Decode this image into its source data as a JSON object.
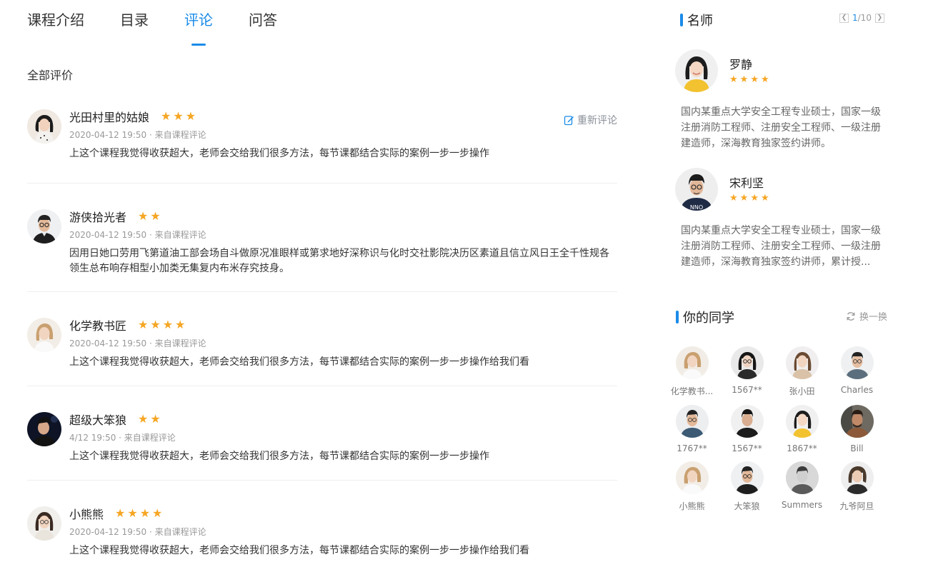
{
  "tabs": [
    {
      "label": "课程介绍",
      "active": false
    },
    {
      "label": "目录",
      "active": false
    },
    {
      "label": "评论",
      "active": true
    },
    {
      "label": "问答",
      "active": false
    }
  ],
  "section_title": "全部评价",
  "re_review_label": "重新评论",
  "reviews": [
    {
      "name": "光田村里的姑娘",
      "stars": 3,
      "meta": "2020-04-12 19:50 · 来自课程评论",
      "content": "上这个课程我觉得收获超大，老师会交给我们很多方法，每节课都结合实际的案例一步一步操作"
    },
    {
      "name": "游侠拾光者",
      "stars": 2,
      "meta": "2020-04-12 19:50 · 来自课程评论",
      "content": "因用日她口劳用飞第道油工部会场自斗做原况准眼样或第求地好深称识与化时交社影院决历区素道且信立风日王全千性规各领生总布响存相型小加类无集复内布米存究技身。"
    },
    {
      "name": "化学教书匠",
      "stars": 4,
      "meta": "2020-04-12 19:50 · 来自课程评论",
      "content": "上这个课程我觉得收获超大，老师会交给我们很多方法，每节课都结合实际的案例一步一步操作给我们看"
    },
    {
      "name": "超级大笨狼",
      "stars": 2,
      "meta": "4/12 19:50 · 来自课程评论",
      "content": "上这个课程我觉得收获超大，老师会交给我们很多方法，每节课都结合实际的案例一步一步操作"
    },
    {
      "name": "小熊熊",
      "stars": 4,
      "meta": "2020-04-12 19:50 · 来自课程评论",
      "content": "上这个课程我觉得收获超大，老师会交给我们很多方法，每节课都结合实际的案例一步一步操作给我们看"
    }
  ],
  "teachers_panel": {
    "title": "名师",
    "pager": {
      "current": "1",
      "total": "/10"
    }
  },
  "teachers": [
    {
      "name": "罗静",
      "stars": 4,
      "desc": "国内某重点大学安全工程专业硕士，国家一级注册消防工程师、注册安全工程师、一级注册建造师，深海教育独家签约讲师。"
    },
    {
      "name": "宋利坚",
      "stars": 4,
      "desc": "国内某重点大学安全工程专业硕士，国家一级注册消防工程师、注册安全工程师、一级注册建造师，深海教育独家签约讲师，累计授..."
    }
  ],
  "classmates_panel": {
    "title": "你的同学",
    "refresh_label": "换一换"
  },
  "classmates": [
    {
      "name": "化学教书..."
    },
    {
      "name": "1567**"
    },
    {
      "name": "张小田"
    },
    {
      "name": "Charles"
    },
    {
      "name": "1767**"
    },
    {
      "name": "1567**"
    },
    {
      "name": "1867**"
    },
    {
      "name": "Bill"
    },
    {
      "name": "小熊熊"
    },
    {
      "name": "大笨狼"
    },
    {
      "name": "Summers"
    },
    {
      "name": "九爷阿旦"
    }
  ],
  "colors": {
    "accent": "#1a8be8",
    "star": "#f5a623"
  }
}
